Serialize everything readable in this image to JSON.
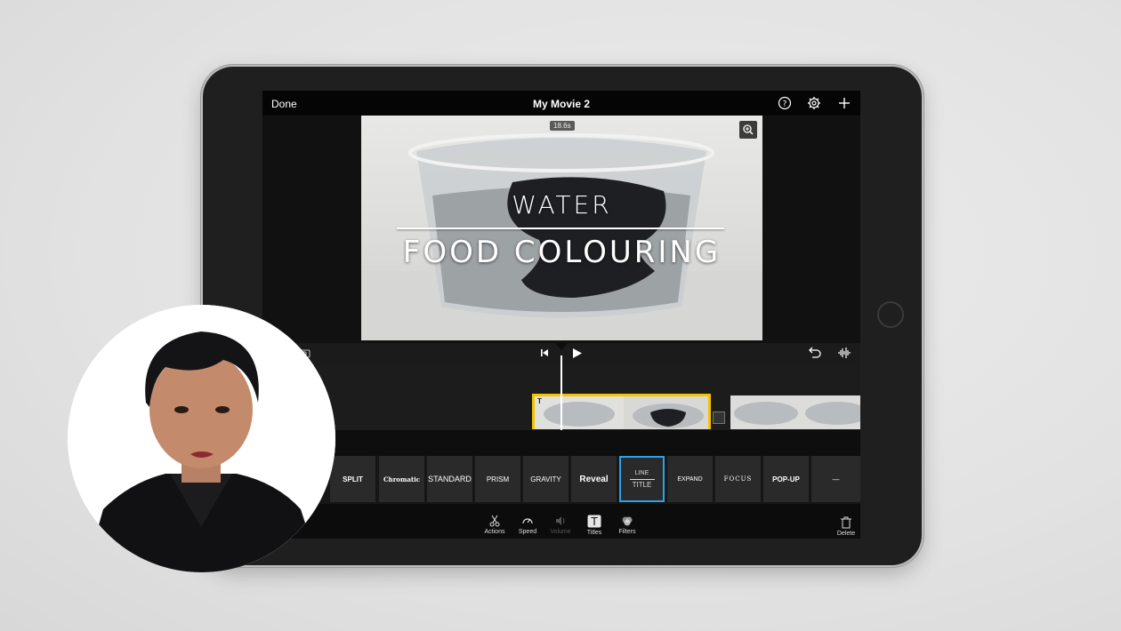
{
  "app": {
    "done_label": "Done",
    "project_title": "My Movie 2"
  },
  "viewer": {
    "duration_badge": "18.6s",
    "title_line1": "WATER",
    "title_line2": "FOOD COLOURING"
  },
  "title_styles": [
    {
      "label": "SPLIT"
    },
    {
      "label": "Chromatic"
    },
    {
      "label": "STANDARD"
    },
    {
      "label": "PRISM"
    },
    {
      "label": "GRAVITY"
    },
    {
      "label": "Reveal"
    },
    {
      "label": "LINE TITLE",
      "line1": "LINE",
      "line2": "TITLE",
      "selected": true
    },
    {
      "label": "EXPAND"
    },
    {
      "label": "FOCUS"
    },
    {
      "label": "POP-UP"
    },
    {
      "label": "—"
    }
  ],
  "toolbar": {
    "actions": "Actions",
    "speed": "Speed",
    "volume": "Volume",
    "titles": "Titles",
    "filters": "Filters",
    "delete": "Delete"
  },
  "colors": {
    "selection_accent": "#2ba3e8",
    "clip_selected_border": "#f5c400"
  }
}
